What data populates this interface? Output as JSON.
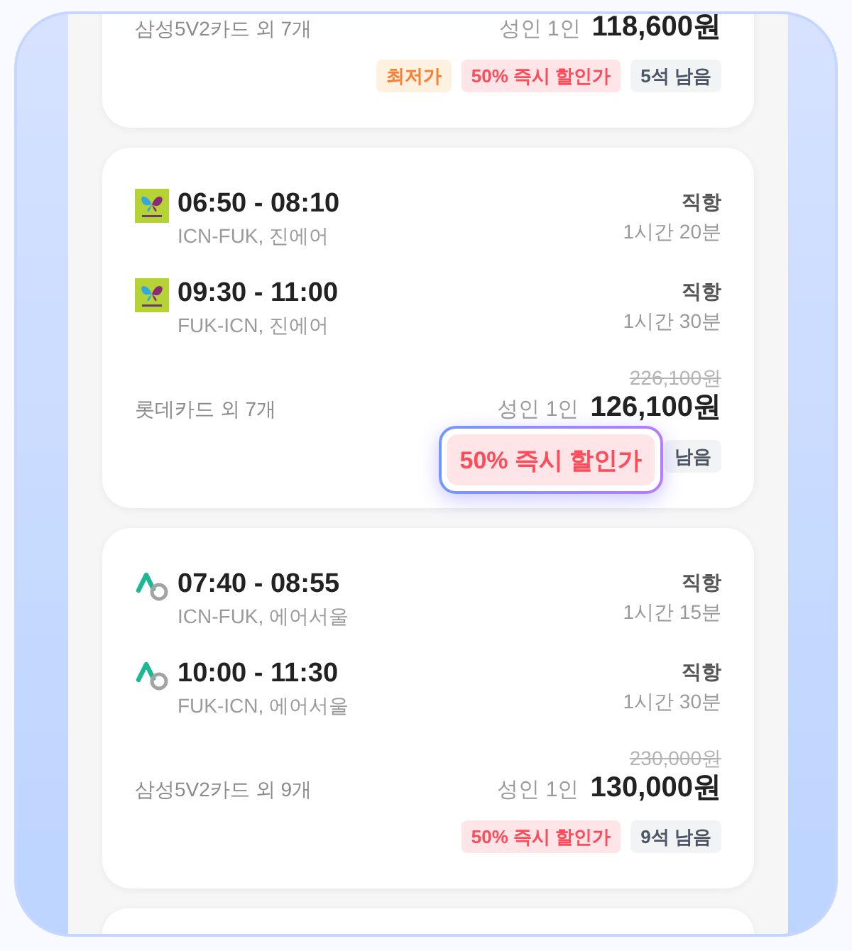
{
  "cards": [
    {
      "offer": "삼성5V2카드 외 7개",
      "passenger": "성인 1인",
      "price": "118,600원",
      "badges": [
        {
          "kind": "lowest",
          "label": "최저가"
        },
        {
          "kind": "discount",
          "label": "50% 즉시 할인가"
        },
        {
          "kind": "seats",
          "label": "5석 남음"
        }
      ]
    },
    {
      "legs": [
        {
          "kind": "butterfly",
          "times": "06:50 - 08:10",
          "route": "ICN-FUK, 진에어",
          "stops": "직항",
          "duration": "1시간 20분"
        },
        {
          "kind": "butterfly",
          "times": "09:30 - 11:00",
          "route": "FUK-ICN, 진에어",
          "stops": "직항",
          "duration": "1시간 30분"
        }
      ],
      "original_price": "226,100원",
      "offer": "롯데카드 외 7개",
      "passenger": "성인 1인",
      "price": "126,100원",
      "highlight": {
        "kind": "discount",
        "label": "50% 즉시 할인가"
      },
      "badges": [
        {
          "kind": "seats",
          "label": "남음"
        }
      ]
    },
    {
      "legs": [
        {
          "kind": "ring",
          "times": "07:40 - 08:55",
          "route": "ICN-FUK, 에어서울",
          "stops": "직항",
          "duration": "1시간 15분"
        },
        {
          "kind": "ring",
          "times": "10:00 - 11:30",
          "route": "FUK-ICN, 에어서울",
          "stops": "직항",
          "duration": "1시간 30분"
        }
      ],
      "original_price": "230,000원",
      "offer": "삼성5V2카드 외 9개",
      "passenger": "성인 1인",
      "price": "130,000원",
      "badges": [
        {
          "kind": "discount",
          "label": "50% 즉시 할인가"
        },
        {
          "kind": "seats",
          "label": "9석 남음"
        }
      ]
    }
  ]
}
